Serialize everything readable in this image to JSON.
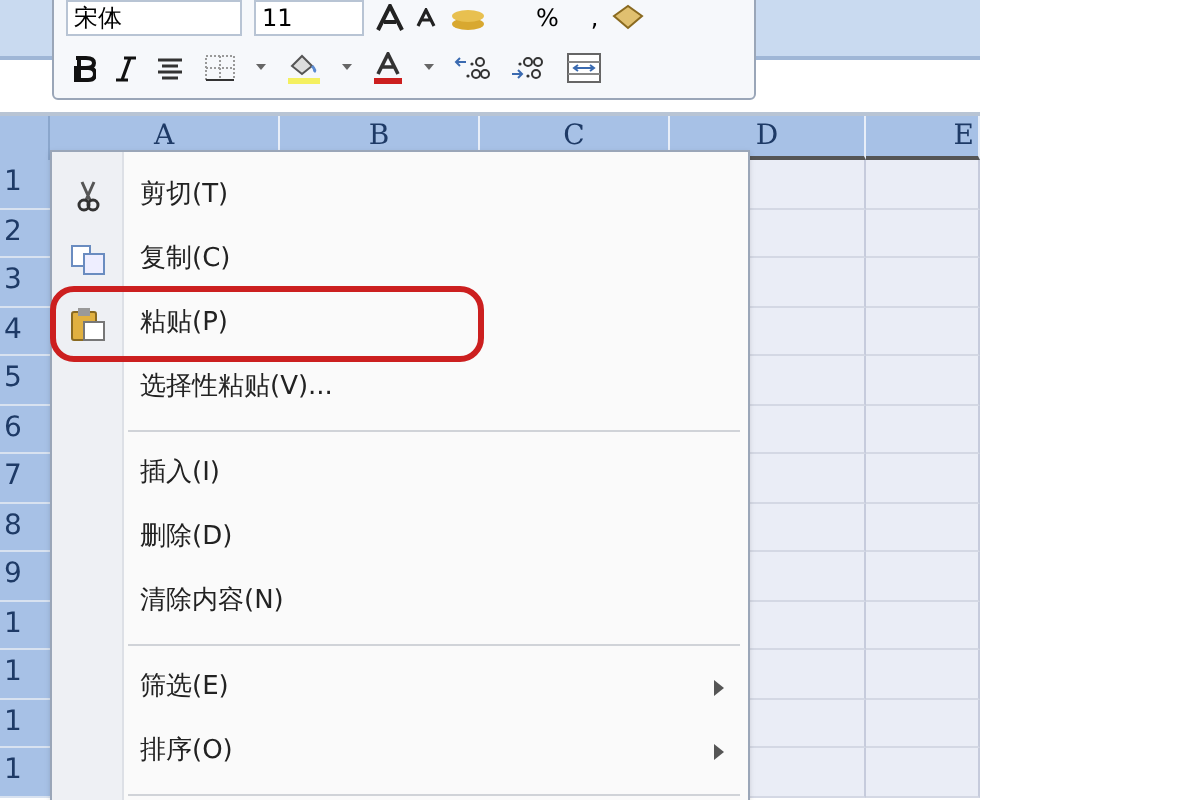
{
  "mini_toolbar": {
    "font": "宋体",
    "size": "11",
    "percent": "%",
    "comma": ","
  },
  "columns": [
    "A",
    "B",
    "C",
    "D",
    "E"
  ],
  "rows": [
    "1",
    "2",
    "3",
    "4",
    "5",
    "6",
    "7",
    "8",
    "9",
    "1",
    "1",
    "1",
    "1"
  ],
  "context_menu": [
    {
      "kind": "item",
      "label": "剪切(T)",
      "circled": false,
      "submenu": false
    },
    {
      "kind": "item",
      "label": "复制(C)",
      "circled": false,
      "submenu": false
    },
    {
      "kind": "item",
      "label": "粘贴(P)",
      "circled": true,
      "submenu": false
    },
    {
      "kind": "item",
      "label": "选择性粘贴(V)...",
      "circled": false,
      "submenu": false
    },
    {
      "kind": "separator"
    },
    {
      "kind": "item",
      "label": "插入(I)",
      "circled": false,
      "submenu": false
    },
    {
      "kind": "item",
      "label": "删除(D)",
      "circled": false,
      "submenu": false
    },
    {
      "kind": "item",
      "label": "清除内容(N)",
      "circled": false,
      "submenu": false
    },
    {
      "kind": "separator"
    },
    {
      "kind": "item",
      "label": "筛选(E)",
      "circled": false,
      "submenu": true
    },
    {
      "kind": "item",
      "label": "排序(O)",
      "circled": false,
      "submenu": true
    },
    {
      "kind": "separator"
    }
  ]
}
